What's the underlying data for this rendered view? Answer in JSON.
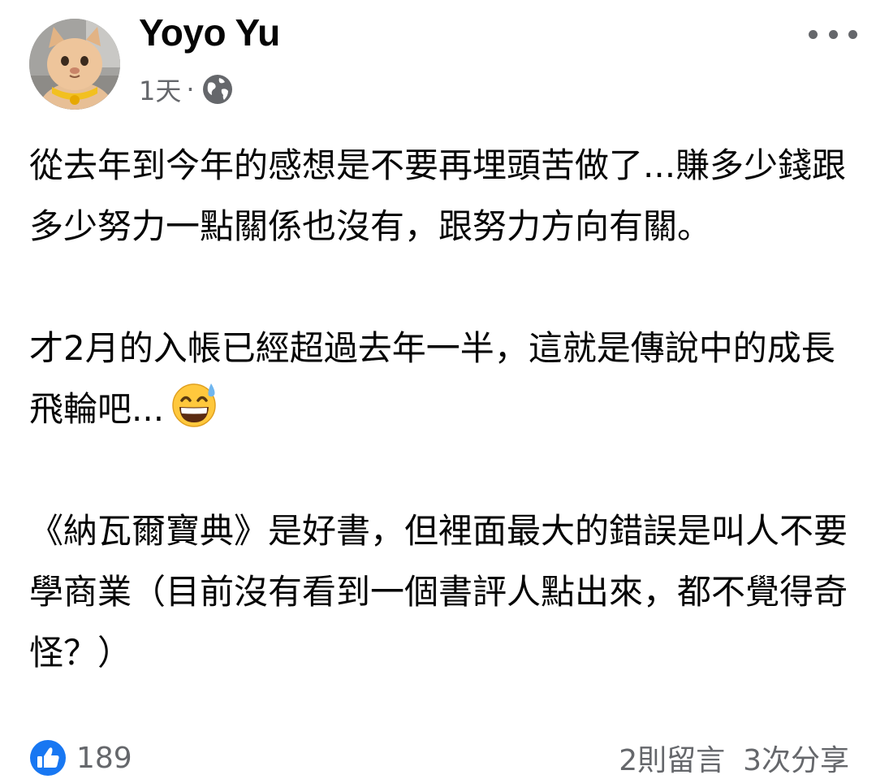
{
  "post": {
    "author_name": "Yoyo Yu",
    "timestamp": "1天",
    "separator": "·",
    "privacy_icon": "globe-icon",
    "more_icon": "more-options-icon",
    "paragraphs": [
      "從去年到今年的感想是不要再埋頭苦做了...賺多少錢跟多少努力一點關係也沒有，跟努力方向有關。",
      "才2月的入帳已經超過去年一半，這就是傳說中的成長飛輪吧...",
      "《納瓦爾寶典》是好書，但裡面最大的錯誤是叫人不要學商業（目前沒有看到一個書評人點出來，都不覺得奇怪？）"
    ],
    "emoji": "grinning-face-with-sweat-icon"
  },
  "footer": {
    "like_icon": "like-icon",
    "reaction_count": "189",
    "comments": "2則留言",
    "shares": "3次分享"
  },
  "colors": {
    "accent_blue": "#1877f2",
    "secondary_text": "#65676b",
    "primary_text": "#050505"
  }
}
